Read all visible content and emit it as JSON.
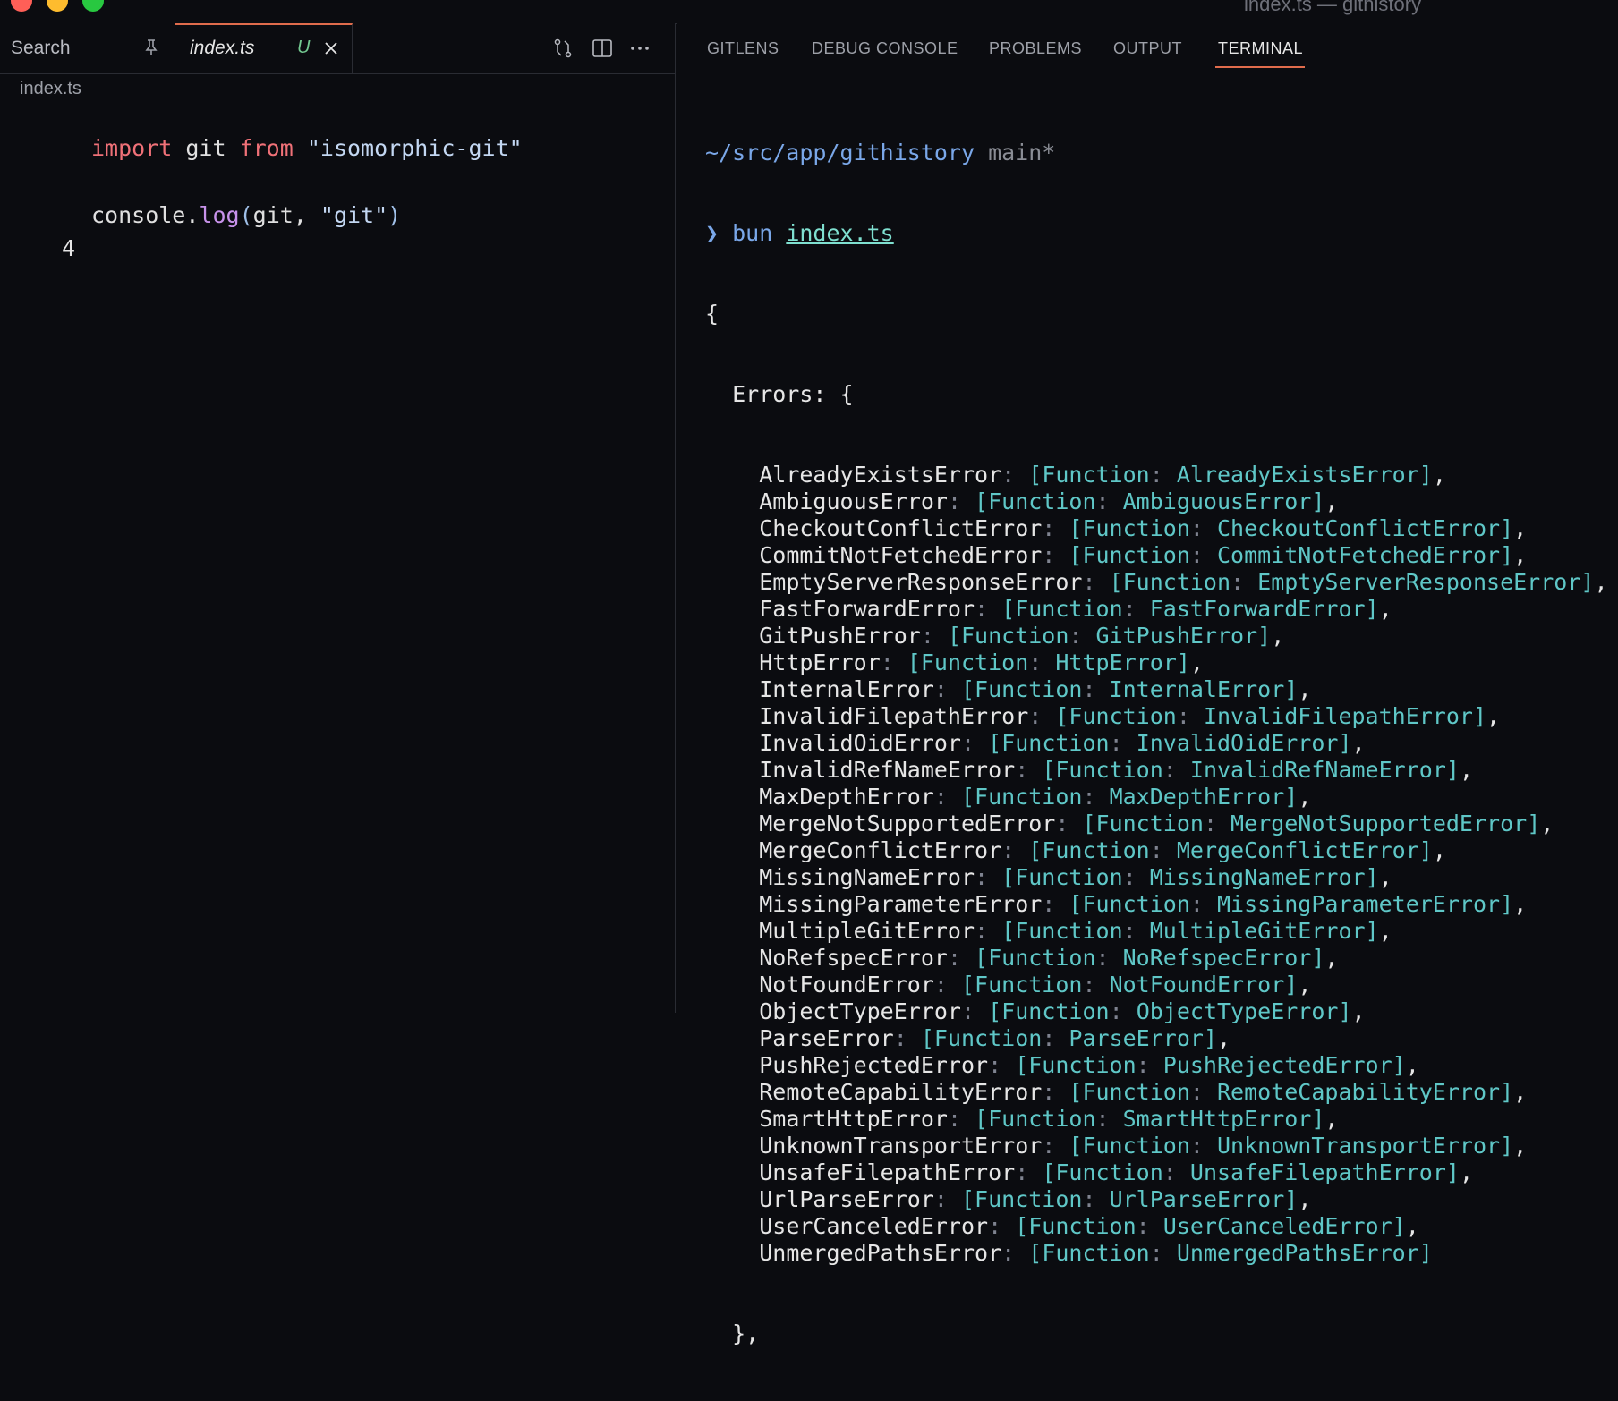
{
  "window": {
    "title": "index.ts — githistory"
  },
  "editor": {
    "tabs": {
      "search_label": "Search",
      "active_file": "index.ts",
      "active_status": "U"
    },
    "breadcrumb": "index.ts",
    "line_number_shown": "4",
    "code": {
      "line1": {
        "kw_import": "import",
        "id_git": " git ",
        "kw_from": "from",
        "str_module": " \"isomorphic-git\""
      },
      "line3": {
        "obj": "console.",
        "method": "log",
        "open": "(",
        "arg1": "git, ",
        "arg2": "\"git\"",
        "close": ")"
      }
    }
  },
  "panel": {
    "tabs": [
      "GITLENS",
      "DEBUG CONSOLE",
      "PROBLEMS",
      "OUTPUT",
      "TERMINAL"
    ],
    "active_tab": "TERMINAL"
  },
  "terminal": {
    "cwd": "~/src/app/githistory",
    "branch": " main*",
    "prompt_symbol": "❯",
    "command": " bun ",
    "command_arg": "index.ts",
    "open_brace": "{",
    "errors_key": "  Errors",
    "errors_open": ": {",
    "error_entries": [
      "AlreadyExistsError",
      "AmbiguousError",
      "CheckoutConflictError",
      "CommitNotFetchedError",
      "EmptyServerResponseError",
      "FastForwardError",
      "GitPushError",
      "HttpError",
      "InternalError",
      "InvalidFilepathError",
      "InvalidOidError",
      "InvalidRefNameError",
      "MaxDepthError",
      "MergeNotSupportedError",
      "MergeConflictError",
      "MissingNameError",
      "MissingParameterError",
      "MultipleGitError",
      "NoRefspecError",
      "NotFoundError",
      "ObjectTypeError",
      "ParseError",
      "PushRejectedError",
      "RemoteCapabilityError",
      "SmartHttpError",
      "UnknownTransportError",
      "UnsafeFilepathError",
      "UrlParseError",
      "UserCanceledError",
      "UnmergedPathsError"
    ],
    "function_label": "[Function",
    "closing_partial": "  },"
  },
  "colors": {
    "accent": "#e06c4c",
    "untracked": "#73c991",
    "function_cyan": "#5fc7c7",
    "keyword": "#f07178"
  }
}
